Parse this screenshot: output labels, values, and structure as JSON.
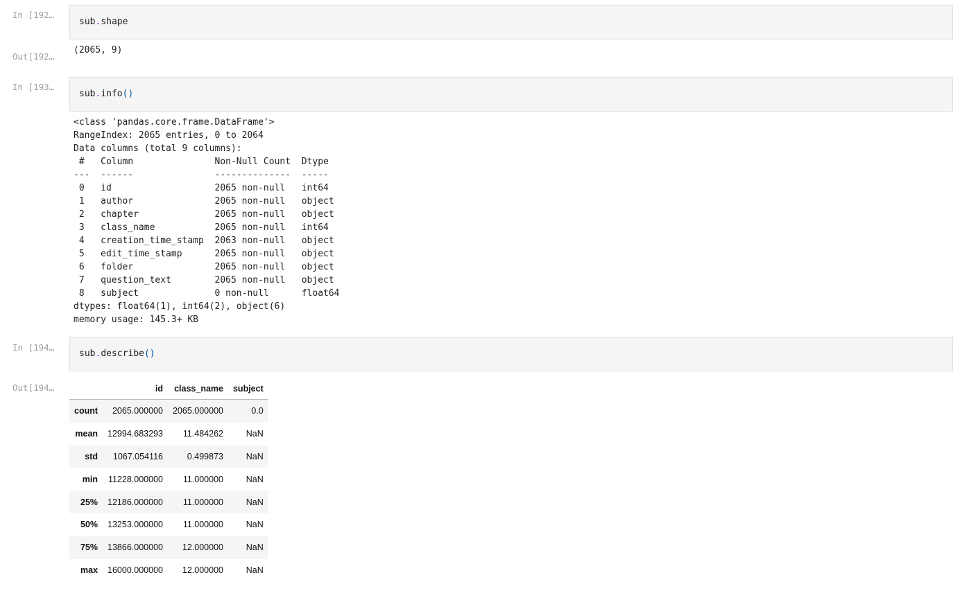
{
  "cells": [
    {
      "prompt_in": "In [192…",
      "prompt_out": "Out[192…",
      "code_obj": "sub",
      "code_dot": ".",
      "code_attr": "shape",
      "output": "(2065, 9)"
    },
    {
      "prompt_in": "In [193…",
      "code_obj": "sub",
      "code_dot": ".",
      "code_attr": "info",
      "code_parens": "()",
      "output_lines": "<class 'pandas.core.frame.DataFrame'>\nRangeIndex: 2065 entries, 0 to 2064\nData columns (total 9 columns):\n #   Column               Non-Null Count  Dtype  \n---  ------               --------------  -----  \n 0   id                   2065 non-null   int64  \n 1   author               2065 non-null   object \n 2   chapter              2065 non-null   object \n 3   class_name           2065 non-null   int64  \n 4   creation_time_stamp  2063 non-null   object \n 5   edit_time_stamp      2065 non-null   object \n 6   folder               2065 non-null   object \n 7   question_text        2065 non-null   object \n 8   subject              0 non-null      float64\ndtypes: float64(1), int64(2), object(6)\nmemory usage: 145.3+ KB"
    },
    {
      "prompt_in": "In [194…",
      "prompt_out": "Out[194…",
      "code_obj": "sub",
      "code_dot": ".",
      "code_attr": "describe",
      "code_parens": "()"
    }
  ],
  "describe_table": {
    "columns": [
      "",
      "id",
      "class_name",
      "subject"
    ],
    "rows": [
      {
        "label": "count",
        "values": [
          "2065.000000",
          "2065.000000",
          "0.0"
        ]
      },
      {
        "label": "mean",
        "values": [
          "12994.683293",
          "11.484262",
          "NaN"
        ]
      },
      {
        "label": "std",
        "values": [
          "1067.054116",
          "0.499873",
          "NaN"
        ]
      },
      {
        "label": "min",
        "values": [
          "11228.000000",
          "11.000000",
          "NaN"
        ]
      },
      {
        "label": "25%",
        "values": [
          "12186.000000",
          "11.000000",
          "NaN"
        ]
      },
      {
        "label": "50%",
        "values": [
          "13253.000000",
          "11.000000",
          "NaN"
        ]
      },
      {
        "label": "75%",
        "values": [
          "13866.000000",
          "12.000000",
          "NaN"
        ]
      },
      {
        "label": "max",
        "values": [
          "16000.000000",
          "12.000000",
          "NaN"
        ]
      }
    ]
  }
}
